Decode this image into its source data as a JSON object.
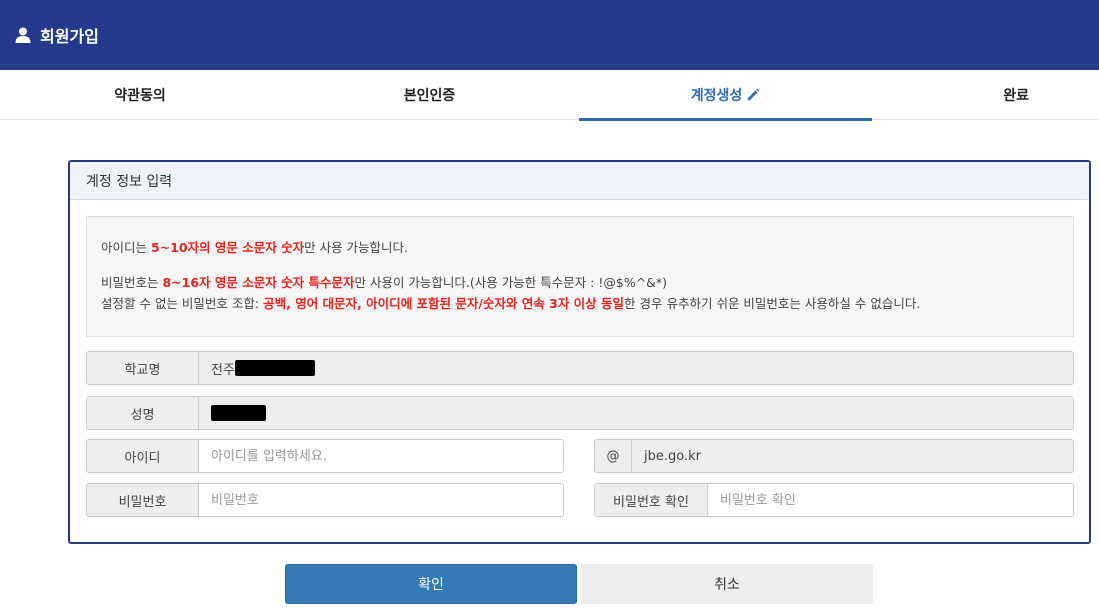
{
  "header": {
    "title": "회원가입",
    "icon": "user-icon"
  },
  "steps": [
    {
      "label": "약관동의"
    },
    {
      "label": "본인인증"
    },
    {
      "label": "계정생성",
      "active": true,
      "icon": "pencil-icon"
    },
    {
      "label": "완료"
    }
  ],
  "panel": {
    "heading": "계정 정보 입력",
    "notice": {
      "line1_pre": "아이디는 ",
      "line1_red": "5~10자의 영문 소문자 숫자",
      "line1_post": "만 사용 가능합니다.",
      "line2_pre": "비밀번호는 ",
      "line2_red": "8~16자 영문 소문자 숫자 특수문자",
      "line2_post": "만 사용이 가능합니다.(사용 가능한 특수문자 : !@$%^&*)",
      "line3_pre": "설정할 수 없는 비밀번호 조합: ",
      "line3_red": "공백, 영어 대문자, 아이디에 포함된 문자/숫자와 연속 3자 이상 동일",
      "line3_post": "한 경우 유추하기 쉬운 비밀번호는 사용하실 수 없습니다."
    },
    "fields": {
      "school": {
        "label": "학교명",
        "value_prefix": "전주"
      },
      "name": {
        "label": "성명"
      },
      "userid": {
        "label": "아이디",
        "placeholder": "아이디를 입력하세요."
      },
      "domain": {
        "label": "@",
        "value": "jbe.go.kr"
      },
      "password": {
        "label": "비밀번호",
        "placeholder": "비밀번호"
      },
      "password_confirm": {
        "label": "비밀번호 확인",
        "placeholder": "비밀번호 확인"
      }
    }
  },
  "buttons": {
    "confirm": "확인",
    "cancel": "취소"
  },
  "colors": {
    "header_bg": "#253a8c",
    "active_tab": "#2d6db3",
    "primary_button": "#337ab7",
    "warning_text": "#e8231e"
  }
}
